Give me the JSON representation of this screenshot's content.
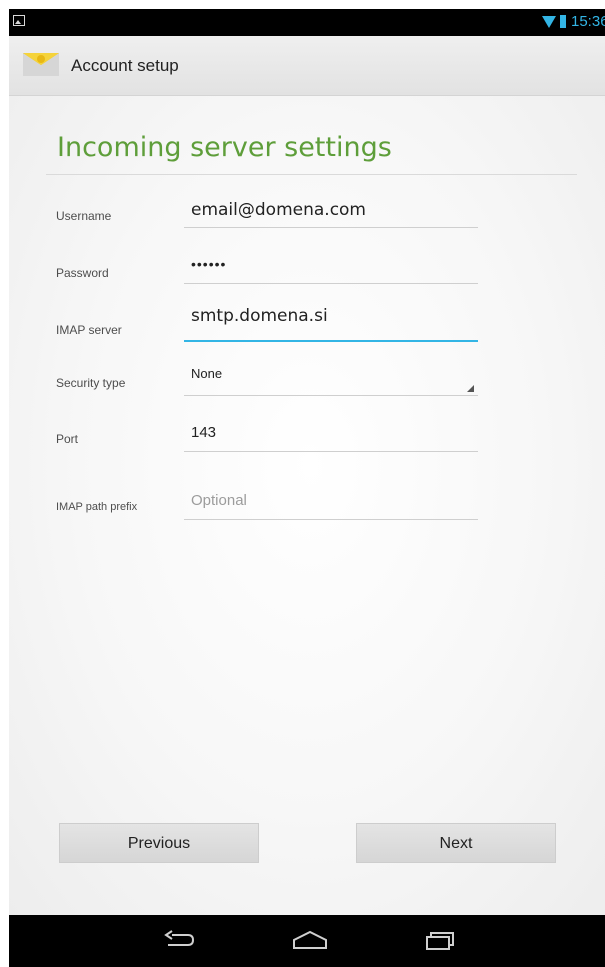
{
  "status_bar": {
    "time": "15:36",
    "icons": [
      "picture-icon",
      "wifi-icon",
      "battery-icon"
    ]
  },
  "action_bar": {
    "title": "Account setup",
    "icon": "email-app-icon"
  },
  "form": {
    "title": "Incoming server settings",
    "fields": {
      "username": {
        "label": "Username",
        "value": "email@domena.com"
      },
      "password": {
        "label": "Password",
        "value": "••••••"
      },
      "imap_server": {
        "label": "IMAP server",
        "value": "smtp.domena.si"
      },
      "security_type": {
        "label": "Security type",
        "value": "None"
      },
      "port": {
        "label": "Port",
        "value": "143"
      },
      "imap_path_prefix": {
        "label": "IMAP path prefix",
        "placeholder": "Optional"
      }
    }
  },
  "buttons": {
    "previous": "Previous",
    "next": "Next"
  },
  "nav_bar": {
    "icons": [
      "back-icon",
      "home-icon",
      "recent-apps-icon"
    ]
  },
  "colors": {
    "accent": "#33b5e5",
    "title_green": "#5e9e3a",
    "bar_background": "#000000"
  }
}
